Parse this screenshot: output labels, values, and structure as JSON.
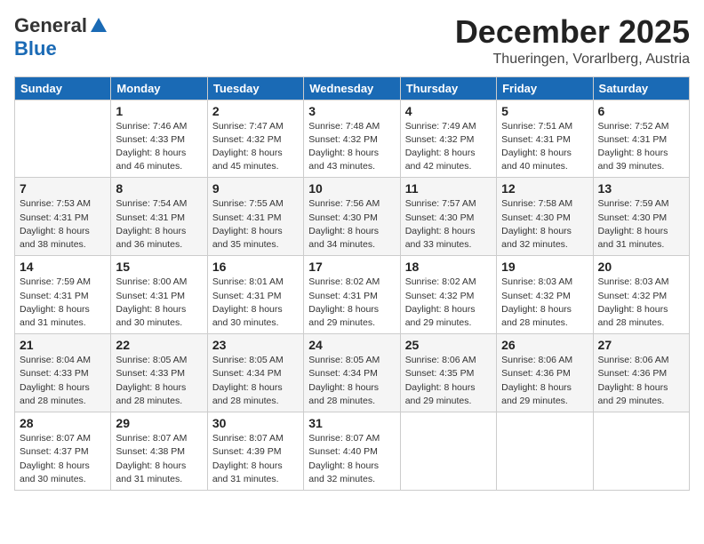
{
  "logo": {
    "general": "General",
    "blue": "Blue"
  },
  "title": "December 2025",
  "location": "Thueringen, Vorarlberg, Austria",
  "days_of_week": [
    "Sunday",
    "Monday",
    "Tuesday",
    "Wednesday",
    "Thursday",
    "Friday",
    "Saturday"
  ],
  "weeks": [
    [
      {
        "day": "",
        "info": ""
      },
      {
        "day": "1",
        "info": "Sunrise: 7:46 AM\nSunset: 4:33 PM\nDaylight: 8 hours\nand 46 minutes."
      },
      {
        "day": "2",
        "info": "Sunrise: 7:47 AM\nSunset: 4:32 PM\nDaylight: 8 hours\nand 45 minutes."
      },
      {
        "day": "3",
        "info": "Sunrise: 7:48 AM\nSunset: 4:32 PM\nDaylight: 8 hours\nand 43 minutes."
      },
      {
        "day": "4",
        "info": "Sunrise: 7:49 AM\nSunset: 4:32 PM\nDaylight: 8 hours\nand 42 minutes."
      },
      {
        "day": "5",
        "info": "Sunrise: 7:51 AM\nSunset: 4:31 PM\nDaylight: 8 hours\nand 40 minutes."
      },
      {
        "day": "6",
        "info": "Sunrise: 7:52 AM\nSunset: 4:31 PM\nDaylight: 8 hours\nand 39 minutes."
      }
    ],
    [
      {
        "day": "7",
        "info": "Sunrise: 7:53 AM\nSunset: 4:31 PM\nDaylight: 8 hours\nand 38 minutes."
      },
      {
        "day": "8",
        "info": "Sunrise: 7:54 AM\nSunset: 4:31 PM\nDaylight: 8 hours\nand 36 minutes."
      },
      {
        "day": "9",
        "info": "Sunrise: 7:55 AM\nSunset: 4:31 PM\nDaylight: 8 hours\nand 35 minutes."
      },
      {
        "day": "10",
        "info": "Sunrise: 7:56 AM\nSunset: 4:30 PM\nDaylight: 8 hours\nand 34 minutes."
      },
      {
        "day": "11",
        "info": "Sunrise: 7:57 AM\nSunset: 4:30 PM\nDaylight: 8 hours\nand 33 minutes."
      },
      {
        "day": "12",
        "info": "Sunrise: 7:58 AM\nSunset: 4:30 PM\nDaylight: 8 hours\nand 32 minutes."
      },
      {
        "day": "13",
        "info": "Sunrise: 7:59 AM\nSunset: 4:30 PM\nDaylight: 8 hours\nand 31 minutes."
      }
    ],
    [
      {
        "day": "14",
        "info": "Sunrise: 7:59 AM\nSunset: 4:31 PM\nDaylight: 8 hours\nand 31 minutes."
      },
      {
        "day": "15",
        "info": "Sunrise: 8:00 AM\nSunset: 4:31 PM\nDaylight: 8 hours\nand 30 minutes."
      },
      {
        "day": "16",
        "info": "Sunrise: 8:01 AM\nSunset: 4:31 PM\nDaylight: 8 hours\nand 30 minutes."
      },
      {
        "day": "17",
        "info": "Sunrise: 8:02 AM\nSunset: 4:31 PM\nDaylight: 8 hours\nand 29 minutes."
      },
      {
        "day": "18",
        "info": "Sunrise: 8:02 AM\nSunset: 4:32 PM\nDaylight: 8 hours\nand 29 minutes."
      },
      {
        "day": "19",
        "info": "Sunrise: 8:03 AM\nSunset: 4:32 PM\nDaylight: 8 hours\nand 28 minutes."
      },
      {
        "day": "20",
        "info": "Sunrise: 8:03 AM\nSunset: 4:32 PM\nDaylight: 8 hours\nand 28 minutes."
      }
    ],
    [
      {
        "day": "21",
        "info": "Sunrise: 8:04 AM\nSunset: 4:33 PM\nDaylight: 8 hours\nand 28 minutes."
      },
      {
        "day": "22",
        "info": "Sunrise: 8:05 AM\nSunset: 4:33 PM\nDaylight: 8 hours\nand 28 minutes."
      },
      {
        "day": "23",
        "info": "Sunrise: 8:05 AM\nSunset: 4:34 PM\nDaylight: 8 hours\nand 28 minutes."
      },
      {
        "day": "24",
        "info": "Sunrise: 8:05 AM\nSunset: 4:34 PM\nDaylight: 8 hours\nand 28 minutes."
      },
      {
        "day": "25",
        "info": "Sunrise: 8:06 AM\nSunset: 4:35 PM\nDaylight: 8 hours\nand 29 minutes."
      },
      {
        "day": "26",
        "info": "Sunrise: 8:06 AM\nSunset: 4:36 PM\nDaylight: 8 hours\nand 29 minutes."
      },
      {
        "day": "27",
        "info": "Sunrise: 8:06 AM\nSunset: 4:36 PM\nDaylight: 8 hours\nand 29 minutes."
      }
    ],
    [
      {
        "day": "28",
        "info": "Sunrise: 8:07 AM\nSunset: 4:37 PM\nDaylight: 8 hours\nand 30 minutes."
      },
      {
        "day": "29",
        "info": "Sunrise: 8:07 AM\nSunset: 4:38 PM\nDaylight: 8 hours\nand 31 minutes."
      },
      {
        "day": "30",
        "info": "Sunrise: 8:07 AM\nSunset: 4:39 PM\nDaylight: 8 hours\nand 31 minutes."
      },
      {
        "day": "31",
        "info": "Sunrise: 8:07 AM\nSunset: 4:40 PM\nDaylight: 8 hours\nand 32 minutes."
      },
      {
        "day": "",
        "info": ""
      },
      {
        "day": "",
        "info": ""
      },
      {
        "day": "",
        "info": ""
      }
    ]
  ]
}
